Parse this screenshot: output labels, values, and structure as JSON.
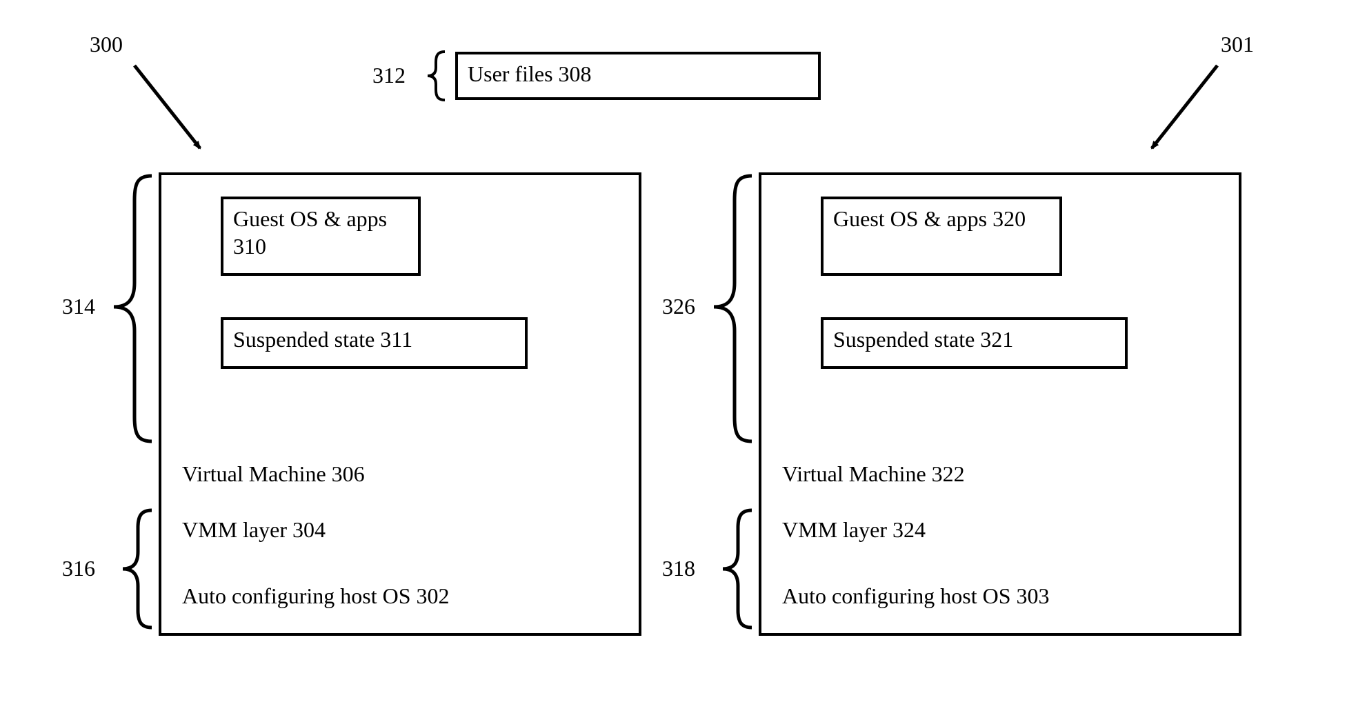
{
  "refs": {
    "ref300": "300",
    "ref301": "301",
    "ref312": "312",
    "ref314": "314",
    "ref316": "316",
    "ref326": "326",
    "ref318": "318"
  },
  "top": {
    "user_files": "User files 308"
  },
  "left": {
    "guest_os": "Guest OS & apps 310",
    "suspended": "Suspended state 311",
    "vm": "Virtual Machine 306",
    "vmm": "VMM layer 304",
    "host_os": "Auto configuring host OS 302"
  },
  "right": {
    "guest_os": "Guest OS & apps 320",
    "suspended": "Suspended state 321",
    "vm": "Virtual Machine 322",
    "vmm": "VMM layer 324",
    "host_os": "Auto configuring host OS 303"
  }
}
